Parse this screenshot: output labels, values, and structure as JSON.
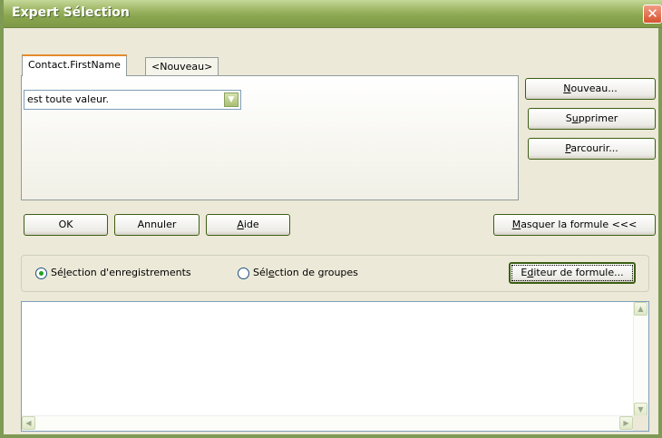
{
  "window": {
    "title": "Expert Sélection",
    "close_glyph": "✕"
  },
  "tabs": [
    {
      "label": "Contact.FirstName",
      "active": true
    },
    {
      "label": "<Nouveau>",
      "active": false
    }
  ],
  "condition": {
    "selected_value": "est toute valeur.",
    "arrow_icon": "chevron-down-icon"
  },
  "side_buttons": {
    "new": {
      "u": "N",
      "rest": "ouveau..."
    },
    "delete": {
      "pre": "S",
      "u": "u",
      "rest": "pprimer"
    },
    "browse": {
      "u": "P",
      "rest": "arcourir..."
    }
  },
  "action_buttons": {
    "ok": "OK",
    "cancel": "Annuler",
    "help": {
      "u": "A",
      "rest": "ide"
    },
    "hide_formula": {
      "u": "M",
      "rest": "asquer la formule <<<"
    }
  },
  "selection_type": {
    "records": {
      "pre": "Sé",
      "u": "l",
      "rest": "ection d'enregistrements",
      "checked": true
    },
    "groups": {
      "pre": "Sél",
      "u": "e",
      "rest": "ction de groupes",
      "checked": false
    }
  },
  "formula_editor_button": {
    "pre": "E",
    "u": "d",
    "rest": "iteur de formule..."
  },
  "formula_text": ""
}
